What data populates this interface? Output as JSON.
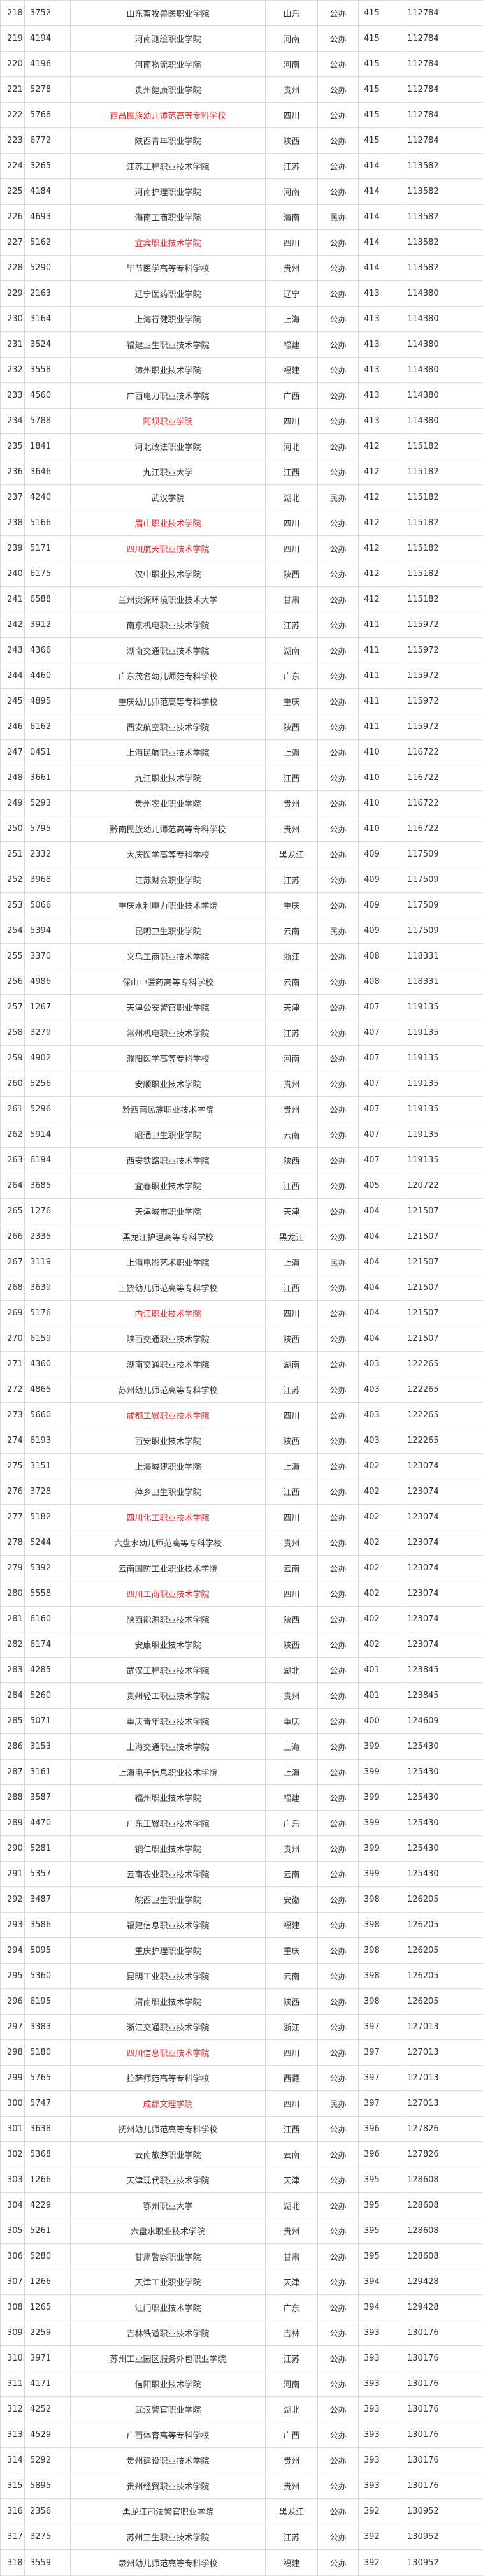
{
  "highlight_color": "#e8282b",
  "rows": [
    {
      "rank": "218",
      "code": "3752",
      "name": "山东畜牧兽医职业学院",
      "province": "山东",
      "type": "公办",
      "score": "415",
      "position": "112784",
      "hl": false
    },
    {
      "rank": "219",
      "code": "4194",
      "name": "河南测绘职业学院",
      "province": "河南",
      "type": "公办",
      "score": "415",
      "position": "112784",
      "hl": false
    },
    {
      "rank": "220",
      "code": "4196",
      "name": "河南物流职业学院",
      "province": "河南",
      "type": "公办",
      "score": "415",
      "position": "112784",
      "hl": false
    },
    {
      "rank": "221",
      "code": "5278",
      "name": "贵州健康职业学院",
      "province": "贵州",
      "type": "公办",
      "score": "415",
      "position": "112784",
      "hl": false
    },
    {
      "rank": "222",
      "code": "5768",
      "name": "西昌民族幼儿师范高等专科学校",
      "province": "四川",
      "type": "公办",
      "score": "415",
      "position": "112784",
      "hl": true
    },
    {
      "rank": "223",
      "code": "6772",
      "name": "陕西青年职业学院",
      "province": "陕西",
      "type": "公办",
      "score": "415",
      "position": "112784",
      "hl": false
    },
    {
      "rank": "224",
      "code": "3265",
      "name": "江苏工程职业技术学院",
      "province": "江苏",
      "type": "公办",
      "score": "414",
      "position": "113582",
      "hl": false
    },
    {
      "rank": "225",
      "code": "4184",
      "name": "河南护理职业学院",
      "province": "河南",
      "type": "公办",
      "score": "414",
      "position": "113582",
      "hl": false
    },
    {
      "rank": "226",
      "code": "4693",
      "name": "海南工商职业学院",
      "province": "海南",
      "type": "民办",
      "score": "414",
      "position": "113582",
      "hl": false
    },
    {
      "rank": "227",
      "code": "5162",
      "name": "宜宾职业技术学院",
      "province": "四川",
      "type": "公办",
      "score": "414",
      "position": "113582",
      "hl": true
    },
    {
      "rank": "228",
      "code": "5290",
      "name": "毕节医学高等专科学校",
      "province": "贵州",
      "type": "公办",
      "score": "414",
      "position": "113582",
      "hl": false
    },
    {
      "rank": "229",
      "code": "2163",
      "name": "辽宁医药职业学院",
      "province": "辽宁",
      "type": "公办",
      "score": "413",
      "position": "114380",
      "hl": false
    },
    {
      "rank": "230",
      "code": "3164",
      "name": "上海行健职业学院",
      "province": "上海",
      "type": "公办",
      "score": "413",
      "position": "114380",
      "hl": false
    },
    {
      "rank": "231",
      "code": "3524",
      "name": "福建卫生职业技术学院",
      "province": "福建",
      "type": "公办",
      "score": "413",
      "position": "114380",
      "hl": false
    },
    {
      "rank": "232",
      "code": "3558",
      "name": "漳州职业技术学院",
      "province": "福建",
      "type": "公办",
      "score": "413",
      "position": "114380",
      "hl": false
    },
    {
      "rank": "233",
      "code": "4560",
      "name": "广西电力职业技术学院",
      "province": "广西",
      "type": "公办",
      "score": "413",
      "position": "114380",
      "hl": false
    },
    {
      "rank": "234",
      "code": "5788",
      "name": "阿坝职业学院",
      "province": "四川",
      "type": "公办",
      "score": "413",
      "position": "114380",
      "hl": true
    },
    {
      "rank": "235",
      "code": "1841",
      "name": "河北政法职业学院",
      "province": "河北",
      "type": "公办",
      "score": "412",
      "position": "115182",
      "hl": false
    },
    {
      "rank": "236",
      "code": "3646",
      "name": "九江职业大学",
      "province": "江西",
      "type": "公办",
      "score": "412",
      "position": "115182",
      "hl": false
    },
    {
      "rank": "237",
      "code": "4240",
      "name": "武汉学院",
      "province": "湖北",
      "type": "民办",
      "score": "412",
      "position": "115182",
      "hl": false
    },
    {
      "rank": "238",
      "code": "5166",
      "name": "眉山职业技术学院",
      "province": "四川",
      "type": "公办",
      "score": "412",
      "position": "115182",
      "hl": true
    },
    {
      "rank": "239",
      "code": "5171",
      "name": "四川航天职业技术学院",
      "province": "四川",
      "type": "公办",
      "score": "412",
      "position": "115182",
      "hl": true
    },
    {
      "rank": "240",
      "code": "6175",
      "name": "汉中职业技术学院",
      "province": "陕西",
      "type": "公办",
      "score": "412",
      "position": "115182",
      "hl": false
    },
    {
      "rank": "241",
      "code": "6588",
      "name": "兰州资源环境职业技术大学",
      "province": "甘肃",
      "type": "公办",
      "score": "412",
      "position": "115182",
      "hl": false
    },
    {
      "rank": "242",
      "code": "3912",
      "name": "南京机电职业技术学院",
      "province": "江苏",
      "type": "公办",
      "score": "411",
      "position": "115972",
      "hl": false
    },
    {
      "rank": "243",
      "code": "4366",
      "name": "湖南交通职业技术学院",
      "province": "湖南",
      "type": "公办",
      "score": "411",
      "position": "115972",
      "hl": false
    },
    {
      "rank": "244",
      "code": "4460",
      "name": "广东茂名幼儿师范专科学校",
      "province": "广东",
      "type": "公办",
      "score": "411",
      "position": "115972",
      "hl": false
    },
    {
      "rank": "245",
      "code": "4895",
      "name": "重庆幼儿师范高等专科学校",
      "province": "重庆",
      "type": "公办",
      "score": "411",
      "position": "115972",
      "hl": false
    },
    {
      "rank": "246",
      "code": "6162",
      "name": "西安航空职业技术学院",
      "province": "陕西",
      "type": "公办",
      "score": "411",
      "position": "115972",
      "hl": false
    },
    {
      "rank": "247",
      "code": "0451",
      "name": "上海民航职业技术学院",
      "province": "上海",
      "type": "公办",
      "score": "410",
      "position": "116722",
      "hl": false
    },
    {
      "rank": "248",
      "code": "3661",
      "name": "九江职业技术学院",
      "province": "江西",
      "type": "公办",
      "score": "410",
      "position": "116722",
      "hl": false
    },
    {
      "rank": "249",
      "code": "5293",
      "name": "贵州农业职业学院",
      "province": "贵州",
      "type": "公办",
      "score": "410",
      "position": "116722",
      "hl": false
    },
    {
      "rank": "250",
      "code": "5795",
      "name": "黔南民族幼儿师范高等专科学校",
      "province": "贵州",
      "type": "公办",
      "score": "410",
      "position": "116722",
      "hl": false
    },
    {
      "rank": "251",
      "code": "2332",
      "name": "大庆医学高等专科学校",
      "province": "黑龙江",
      "type": "公办",
      "score": "409",
      "position": "117509",
      "hl": false
    },
    {
      "rank": "252",
      "code": "3968",
      "name": "江苏财会职业学院",
      "province": "江苏",
      "type": "公办",
      "score": "409",
      "position": "117509",
      "hl": false
    },
    {
      "rank": "253",
      "code": "5066",
      "name": "重庆水利电力职业技术学院",
      "province": "重庆",
      "type": "公办",
      "score": "409",
      "position": "117509",
      "hl": false
    },
    {
      "rank": "254",
      "code": "5394",
      "name": "昆明卫生职业学院",
      "province": "云南",
      "type": "民办",
      "score": "409",
      "position": "117509",
      "hl": false
    },
    {
      "rank": "255",
      "code": "3370",
      "name": "义乌工商职业技术学院",
      "province": "浙江",
      "type": "公办",
      "score": "408",
      "position": "118331",
      "hl": false
    },
    {
      "rank": "256",
      "code": "4986",
      "name": "保山中医药高等专科学校",
      "province": "云南",
      "type": "公办",
      "score": "408",
      "position": "118331",
      "hl": false
    },
    {
      "rank": "257",
      "code": "1267",
      "name": "天津公安警官职业学院",
      "province": "天津",
      "type": "公办",
      "score": "407",
      "position": "119135",
      "hl": false
    },
    {
      "rank": "258",
      "code": "3279",
      "name": "常州机电职业技术学院",
      "province": "江苏",
      "type": "公办",
      "score": "407",
      "position": "119135",
      "hl": false
    },
    {
      "rank": "259",
      "code": "4902",
      "name": "濮阳医学高等专科学校",
      "province": "河南",
      "type": "公办",
      "score": "407",
      "position": "119135",
      "hl": false
    },
    {
      "rank": "260",
      "code": "5256",
      "name": "安顺职业技术学院",
      "province": "贵州",
      "type": "公办",
      "score": "407",
      "position": "119135",
      "hl": false
    },
    {
      "rank": "261",
      "code": "5296",
      "name": "黔西南民族职业技术学院",
      "province": "贵州",
      "type": "公办",
      "score": "407",
      "position": "119135",
      "hl": false
    },
    {
      "rank": "262",
      "code": "5914",
      "name": "昭通卫生职业学院",
      "province": "云南",
      "type": "公办",
      "score": "407",
      "position": "119135",
      "hl": false
    },
    {
      "rank": "263",
      "code": "6194",
      "name": "西安铁路职业技术学院",
      "province": "陕西",
      "type": "公办",
      "score": "407",
      "position": "119135",
      "hl": false
    },
    {
      "rank": "264",
      "code": "3685",
      "name": "宜春职业技术学院",
      "province": "江西",
      "type": "公办",
      "score": "405",
      "position": "120722",
      "hl": false
    },
    {
      "rank": "265",
      "code": "1276",
      "name": "天津城市职业学院",
      "province": "天津",
      "type": "公办",
      "score": "404",
      "position": "121507",
      "hl": false
    },
    {
      "rank": "266",
      "code": "2335",
      "name": "黑龙江护理高等专科学校",
      "province": "黑龙江",
      "type": "公办",
      "score": "404",
      "position": "121507",
      "hl": false
    },
    {
      "rank": "267",
      "code": "3119",
      "name": "上海电影艺术职业学院",
      "province": "上海",
      "type": "民办",
      "score": "404",
      "position": "121507",
      "hl": false
    },
    {
      "rank": "268",
      "code": "3639",
      "name": "上饶幼儿师范高等专科学校",
      "province": "江西",
      "type": "公办",
      "score": "404",
      "position": "121507",
      "hl": false
    },
    {
      "rank": "269",
      "code": "5176",
      "name": "内江职业技术学院",
      "province": "四川",
      "type": "公办",
      "score": "404",
      "position": "121507",
      "hl": true
    },
    {
      "rank": "270",
      "code": "6159",
      "name": "陕西交通职业技术学院",
      "province": "陕西",
      "type": "公办",
      "score": "404",
      "position": "121507",
      "hl": false
    },
    {
      "rank": "271",
      "code": "4360",
      "name": "湖南交通职业技术学院",
      "province": "湖南",
      "type": "公办",
      "score": "403",
      "position": "122265",
      "hl": false
    },
    {
      "rank": "272",
      "code": "4865",
      "name": "苏州幼儿师范高等专科学校",
      "province": "江苏",
      "type": "公办",
      "score": "403",
      "position": "122265",
      "hl": false
    },
    {
      "rank": "273",
      "code": "5660",
      "name": "成都工贸职业技术学院",
      "province": "四川",
      "type": "公办",
      "score": "403",
      "position": "122265",
      "hl": true
    },
    {
      "rank": "274",
      "code": "6193",
      "name": "西安职业技术学院",
      "province": "陕西",
      "type": "公办",
      "score": "403",
      "position": "122265",
      "hl": false
    },
    {
      "rank": "275",
      "code": "3151",
      "name": "上海城建职业学院",
      "province": "上海",
      "type": "公办",
      "score": "402",
      "position": "123074",
      "hl": false
    },
    {
      "rank": "276",
      "code": "3728",
      "name": "萍乡卫生职业学院",
      "province": "江西",
      "type": "公办",
      "score": "402",
      "position": "123074",
      "hl": false
    },
    {
      "rank": "277",
      "code": "5182",
      "name": "四川化工职业技术学院",
      "province": "四川",
      "type": "公办",
      "score": "402",
      "position": "123074",
      "hl": true
    },
    {
      "rank": "278",
      "code": "5244",
      "name": "六盘水幼儿师范高等专科学校",
      "province": "贵州",
      "type": "公办",
      "score": "402",
      "position": "123074",
      "hl": false
    },
    {
      "rank": "279",
      "code": "5392",
      "name": "云南国防工业职业技术学院",
      "province": "云南",
      "type": "公办",
      "score": "402",
      "position": "123074",
      "hl": false
    },
    {
      "rank": "280",
      "code": "5558",
      "name": "四川工商职业技术学院",
      "province": "四川",
      "type": "公办",
      "score": "402",
      "position": "123074",
      "hl": true
    },
    {
      "rank": "281",
      "code": "6160",
      "name": "陕西能源职业技术学院",
      "province": "陕西",
      "type": "公办",
      "score": "402",
      "position": "123074",
      "hl": false
    },
    {
      "rank": "282",
      "code": "6174",
      "name": "安康职业技术学院",
      "province": "陕西",
      "type": "公办",
      "score": "402",
      "position": "123074",
      "hl": false
    },
    {
      "rank": "283",
      "code": "4285",
      "name": "武汉工程职业技术学院",
      "province": "湖北",
      "type": "公办",
      "score": "401",
      "position": "123845",
      "hl": false
    },
    {
      "rank": "284",
      "code": "5260",
      "name": "贵州轻工职业技术学院",
      "province": "贵州",
      "type": "公办",
      "score": "401",
      "position": "123845",
      "hl": false
    },
    {
      "rank": "285",
      "code": "5071",
      "name": "重庆青年职业技术学院",
      "province": "重庆",
      "type": "公办",
      "score": "400",
      "position": "124609",
      "hl": false
    },
    {
      "rank": "286",
      "code": "3153",
      "name": "上海交通职业技术学院",
      "province": "上海",
      "type": "公办",
      "score": "399",
      "position": "125430",
      "hl": false
    },
    {
      "rank": "287",
      "code": "3161",
      "name": "上海电子信息职业技术学院",
      "province": "上海",
      "type": "公办",
      "score": "399",
      "position": "125430",
      "hl": false
    },
    {
      "rank": "288",
      "code": "3587",
      "name": "福州职业技术学院",
      "province": "福建",
      "type": "公办",
      "score": "399",
      "position": "125430",
      "hl": false
    },
    {
      "rank": "289",
      "code": "4470",
      "name": "广东工贸职业技术学院",
      "province": "广东",
      "type": "公办",
      "score": "399",
      "position": "125430",
      "hl": false
    },
    {
      "rank": "290",
      "code": "5281",
      "name": "铜仁职业技术学院",
      "province": "贵州",
      "type": "公办",
      "score": "399",
      "position": "125430",
      "hl": false
    },
    {
      "rank": "291",
      "code": "5357",
      "name": "云南农业职业技术学院",
      "province": "云南",
      "type": "公办",
      "score": "399",
      "position": "125430",
      "hl": false
    },
    {
      "rank": "292",
      "code": "3487",
      "name": "皖西卫生职业学院",
      "province": "安徽",
      "type": "公办",
      "score": "398",
      "position": "126205",
      "hl": false
    },
    {
      "rank": "293",
      "code": "3586",
      "name": "福建信息职业技术学院",
      "province": "福建",
      "type": "公办",
      "score": "398",
      "position": "126205",
      "hl": false
    },
    {
      "rank": "294",
      "code": "5095",
      "name": "重庆护理职业学院",
      "province": "重庆",
      "type": "公办",
      "score": "398",
      "position": "126205",
      "hl": false
    },
    {
      "rank": "295",
      "code": "5360",
      "name": "昆明工业职业技术学院",
      "province": "云南",
      "type": "公办",
      "score": "398",
      "position": "126205",
      "hl": false
    },
    {
      "rank": "296",
      "code": "6195",
      "name": "渭南职业技术学院",
      "province": "陕西",
      "type": "公办",
      "score": "398",
      "position": "126205",
      "hl": false
    },
    {
      "rank": "297",
      "code": "3383",
      "name": "浙江交通职业技术学院",
      "province": "浙江",
      "type": "公办",
      "score": "397",
      "position": "127013",
      "hl": false
    },
    {
      "rank": "298",
      "code": "5180",
      "name": "四川信息职业技术学院",
      "province": "四川",
      "type": "公办",
      "score": "397",
      "position": "127013",
      "hl": true
    },
    {
      "rank": "299",
      "code": "5765",
      "name": "拉萨师范高等专科学校",
      "province": "西藏",
      "type": "公办",
      "score": "397",
      "position": "127013",
      "hl": false
    },
    {
      "rank": "300",
      "code": "5747",
      "name": "成都文理学院",
      "province": "四川",
      "type": "民办",
      "score": "397",
      "position": "127013",
      "hl": true
    },
    {
      "rank": "301",
      "code": "3638",
      "name": "抚州幼儿师范高等专科学校",
      "province": "江西",
      "type": "公办",
      "score": "396",
      "position": "127826",
      "hl": false
    },
    {
      "rank": "302",
      "code": "5368",
      "name": "云南旅游职业学院",
      "province": "云南",
      "type": "公办",
      "score": "396",
      "position": "127826",
      "hl": false
    },
    {
      "rank": "303",
      "code": "1266",
      "name": "天津现代职业技术学院",
      "province": "天津",
      "type": "公办",
      "score": "395",
      "position": "128608",
      "hl": false
    },
    {
      "rank": "304",
      "code": "4229",
      "name": "鄂州职业大学",
      "province": "湖北",
      "type": "公办",
      "score": "395",
      "position": "128608",
      "hl": false
    },
    {
      "rank": "305",
      "code": "5261",
      "name": "六盘水职业技术学院",
      "province": "贵州",
      "type": "公办",
      "score": "395",
      "position": "128608",
      "hl": false
    },
    {
      "rank": "306",
      "code": "5280",
      "name": "甘肃警察职业学院",
      "province": "甘肃",
      "type": "公办",
      "score": "395",
      "position": "128608",
      "hl": false
    },
    {
      "rank": "307",
      "code": "1266",
      "name": "天津工业职业学院",
      "province": "天津",
      "type": "公办",
      "score": "394",
      "position": "129428",
      "hl": false
    },
    {
      "rank": "308",
      "code": "1265",
      "name": "江门职业技术学院",
      "province": "广东",
      "type": "公办",
      "score": "394",
      "position": "129428",
      "hl": false
    },
    {
      "rank": "309",
      "code": "2259",
      "name": "吉林铁道职业技术学院",
      "province": "吉林",
      "type": "公办",
      "score": "393",
      "position": "130176",
      "hl": false
    },
    {
      "rank": "310",
      "code": "3971",
      "name": "苏州工业园区服务外包职业学院",
      "province": "江苏",
      "type": "公办",
      "score": "393",
      "position": "130176",
      "hl": false
    },
    {
      "rank": "311",
      "code": "4171",
      "name": "信阳职业技术学院",
      "province": "河南",
      "type": "公办",
      "score": "393",
      "position": "130176",
      "hl": false
    },
    {
      "rank": "312",
      "code": "4252",
      "name": "武汉警官职业学院",
      "province": "湖北",
      "type": "公办",
      "score": "393",
      "position": "130176",
      "hl": false
    },
    {
      "rank": "313",
      "code": "4529",
      "name": "广西体育高等专科学校",
      "province": "广西",
      "type": "公办",
      "score": "393",
      "position": "130176",
      "hl": false
    },
    {
      "rank": "314",
      "code": "5292",
      "name": "贵州建设职业技术学院",
      "province": "贵州",
      "type": "公办",
      "score": "393",
      "position": "130176",
      "hl": false
    },
    {
      "rank": "315",
      "code": "5895",
      "name": "贵州经贸职业技术学院",
      "province": "贵州",
      "type": "公办",
      "score": "393",
      "position": "130176",
      "hl": false
    },
    {
      "rank": "316",
      "code": "2356",
      "name": "黑龙江司法警官职业学院",
      "province": "黑龙江",
      "type": "公办",
      "score": "392",
      "position": "130952",
      "hl": false
    },
    {
      "rank": "317",
      "code": "3275",
      "name": "苏州卫生职业技术学院",
      "province": "江苏",
      "type": "公办",
      "score": "392",
      "position": "130952",
      "hl": false
    },
    {
      "rank": "318",
      "code": "3559",
      "name": "泉州幼儿师范高等专科学校",
      "province": "福建",
      "type": "公办",
      "score": "392",
      "position": "130952",
      "hl": false
    }
  ]
}
